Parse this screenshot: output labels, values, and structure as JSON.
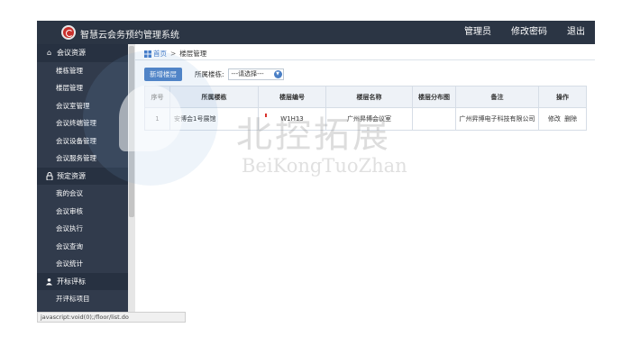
{
  "header": {
    "app_title": "智慧云会务预约管理系统",
    "nav": [
      "管理员",
      "修改密码",
      "退出"
    ]
  },
  "sidebar": {
    "groups": [
      {
        "title": "会议资源",
        "icon": "home-icon",
        "items": [
          "楼栋管理",
          "楼层管理",
          "会议室管理",
          "会议终端管理",
          "会议设备管理",
          "会议服务管理"
        ]
      },
      {
        "title": "预定资源",
        "icon": "lock-icon",
        "items": [
          "我的会议",
          "会议审核",
          "会议执行",
          "会议查询",
          "会议统计"
        ]
      },
      {
        "title": "开标评标",
        "icon": "user-icon",
        "items": [
          "开评标项目"
        ]
      }
    ]
  },
  "breadcrumb": {
    "home": "首页",
    "separator": ">",
    "current": "楼层管理"
  },
  "toolbar": {
    "add_button": "新增楼层",
    "filter_label": "所属楼栋:",
    "select_value": "---请选择---"
  },
  "table": {
    "columns": [
      "序号",
      "所属楼栋",
      "楼层编号",
      "楼层名称",
      "楼层分布图",
      "备注",
      "操作"
    ],
    "rows": [
      {
        "index": "1",
        "building": "安博会1号展馆",
        "code": "W1H13",
        "name": "广州昇博会议室",
        "map": "",
        "remark": "广州昇博电子科技有限公司",
        "actions": [
          "修改",
          "删除"
        ]
      }
    ]
  },
  "watermark": {
    "cn": "北控拓展",
    "en": "BeiKongTuoZhan"
  },
  "status": {
    "url": "javascript:void(0);/floor/list.do"
  },
  "colors": {
    "header_bg": "#2b3544",
    "sidebar_bg": "#313b4c",
    "accent": "#4a7fc5",
    "logo": "#c9302c"
  }
}
